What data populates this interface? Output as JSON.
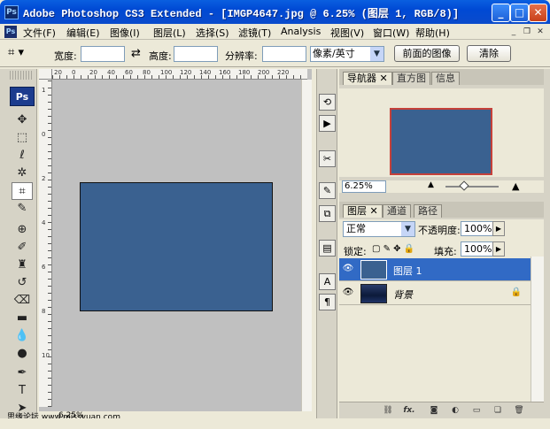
{
  "window": {
    "title": "Adobe Photoshop CS3 Extended - [IMGP4647.jpg @ 6.25% (图层 1, RGB/8)]",
    "buttons": {
      "minimize": "_",
      "maximize": "□",
      "close": "✕"
    }
  },
  "menu": {
    "items": [
      "文件(F)",
      "编辑(E)",
      "图像(I)",
      "图层(L)",
      "选择(S)",
      "滤镜(T)",
      "Analysis",
      "视图(V)",
      "窗口(W)",
      "帮助(H)"
    ]
  },
  "options_bar": {
    "width_label": "宽度:",
    "height_label": "高度:",
    "resolution_label": "分辨率:",
    "unit_select": "像素/英寸",
    "front_image_button": "前面的图像",
    "clear_button": "清除",
    "swap_icon": "⇄"
  },
  "tools": {
    "logo": "Ps",
    "icons": [
      "move-icon",
      "marquee-icon",
      "lasso-icon",
      "magic-wand-icon",
      "crop-icon",
      "slice-icon",
      "healing-icon",
      "brush-icon",
      "stamp-icon",
      "history-brush-icon",
      "eraser-icon",
      "gradient-icon",
      "blur-icon",
      "dodge-icon",
      "pen-icon",
      "type-icon",
      "path-select-icon"
    ]
  },
  "document": {
    "zoom": "6.25%",
    "ruler_top_numbers": [
      "20",
      "0",
      "20",
      "40",
      "60",
      "80",
      "100",
      "120",
      "140",
      "160",
      "180",
      "200",
      "220"
    ],
    "ruler_left_numbers": [
      "1",
      "0",
      "2",
      "4",
      "6",
      "8",
      "10"
    ]
  },
  "watermark": "思缘论坛 www.missyuan.com",
  "navigator": {
    "tabs": [
      "导航器",
      "直方图",
      "信息"
    ],
    "zoom": "6.25%"
  },
  "layers": {
    "tabs": [
      "图层",
      "通道",
      "路径"
    ],
    "blend_mode": "正常",
    "opacity_label": "不透明度:",
    "opacity_value": "100%",
    "lock_label": "锁定:",
    "fill_label": "填充:",
    "fill_value": "100%",
    "rows": [
      {
        "name": "图层 1",
        "selected": true
      },
      {
        "name": "背景",
        "selected": false,
        "locked": true
      }
    ],
    "footer_icons": [
      "link-icon",
      "fx-icon",
      "mask-icon",
      "adjustment-icon",
      "group-icon",
      "new-layer-icon",
      "trash-icon"
    ],
    "footer_fx": "fx."
  },
  "colors": {
    "canvas": "#3a6190",
    "selected_row": "#316ac5",
    "nav_frame": "#c5413a"
  }
}
